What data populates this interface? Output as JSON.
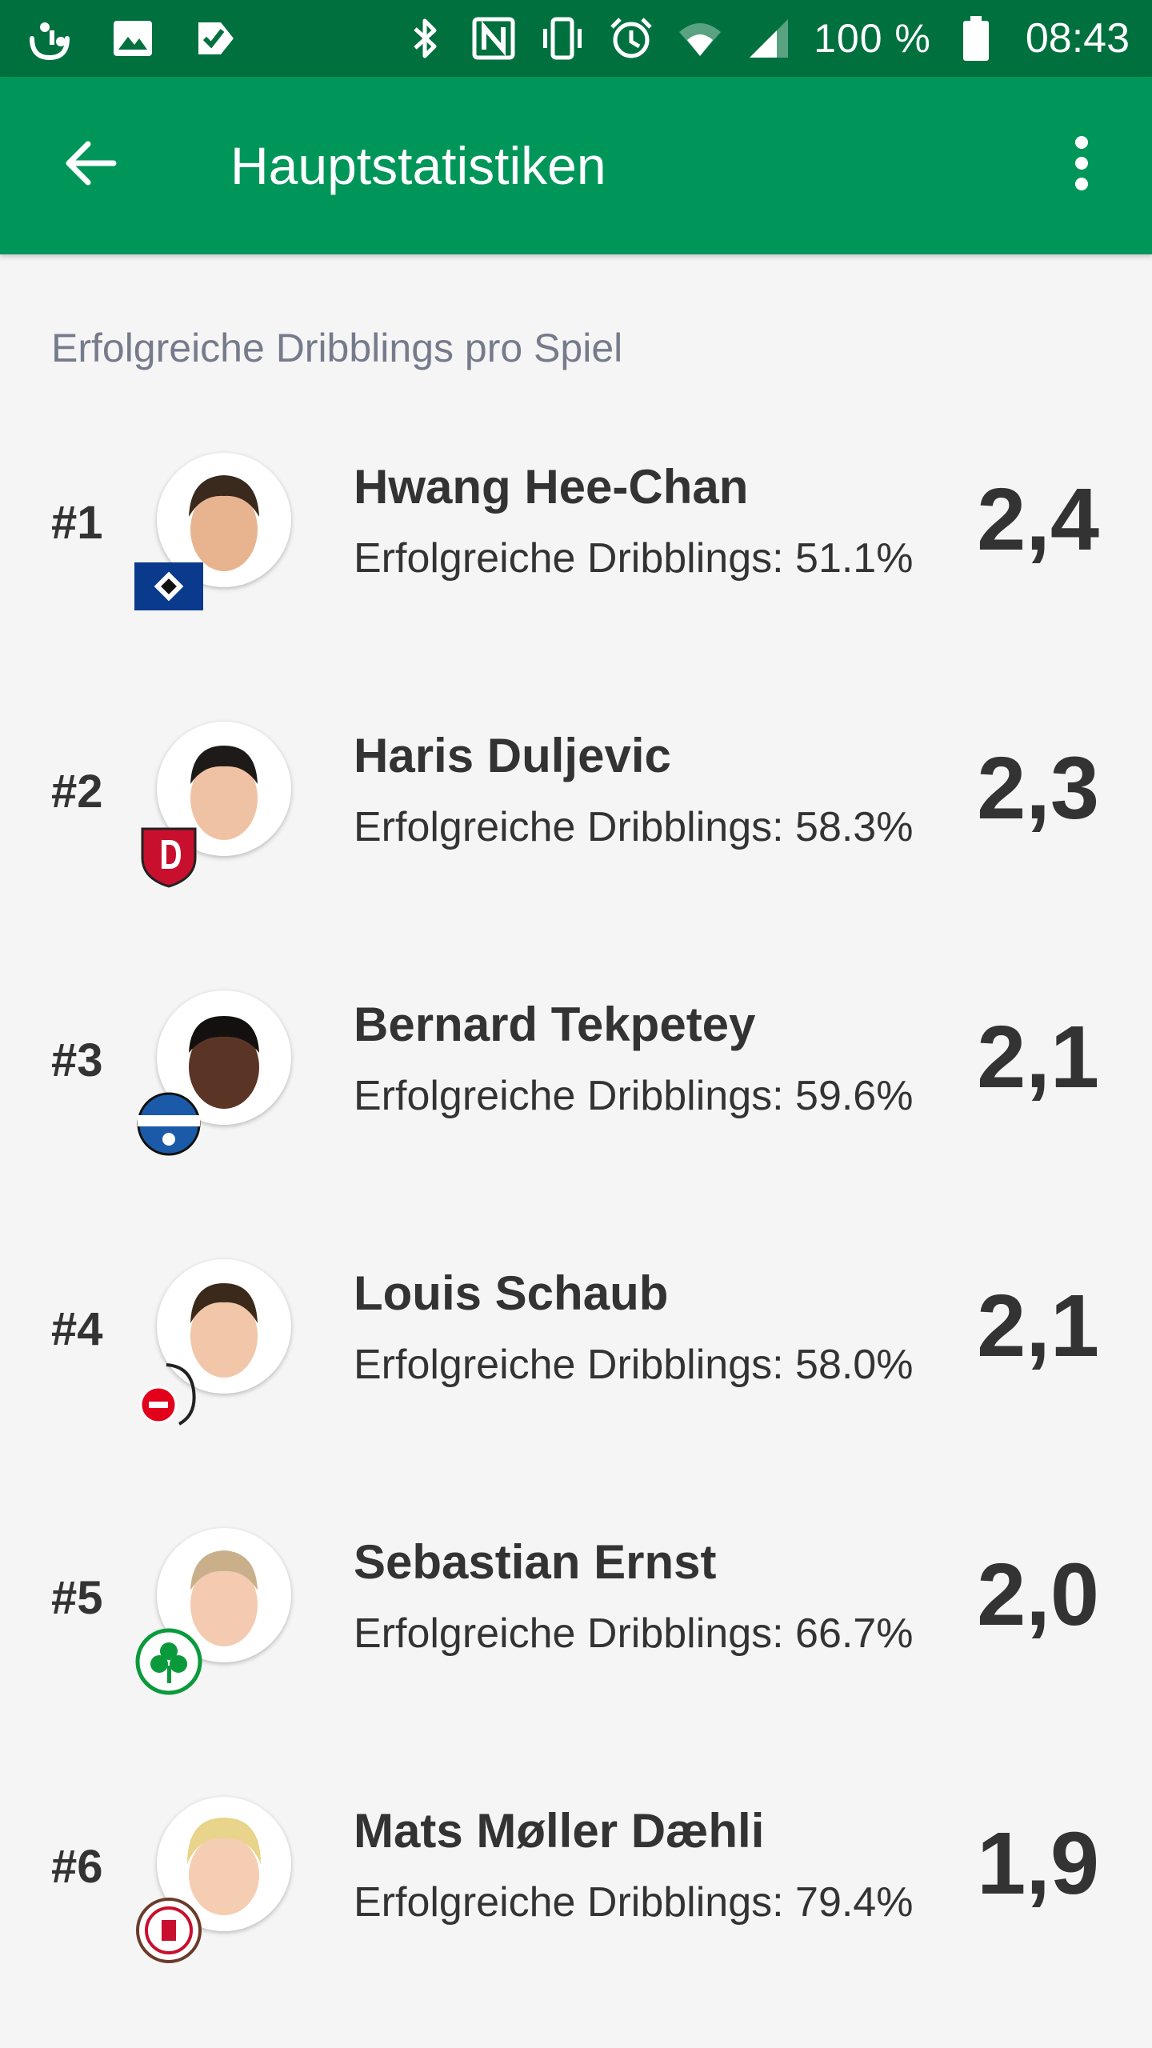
{
  "status_bar": {
    "battery_text": "100 %",
    "time": "08:43",
    "left_icons": [
      "touch-icon",
      "gallery-icon",
      "tasks-icon"
    ],
    "right_icons": [
      "bluetooth-icon",
      "nfc-icon",
      "vibrate-icon",
      "alarm-icon",
      "wifi-icon",
      "signal-icon",
      "battery-icon"
    ]
  },
  "app_bar": {
    "title": "Hauptstatistiken",
    "color": "#00965a",
    "status_color": "#00703f"
  },
  "section": {
    "title": "Erfolgreiche Dribblings pro Spiel"
  },
  "players": [
    {
      "rank": "#1",
      "name": "Hwang Hee-Chan",
      "stat": "Erfolgreiche Dribblings: 51.1%",
      "value": "2,4",
      "club": "hsv-crest-icon",
      "skin": "#e8b48f",
      "hair": "#3a2a1e"
    },
    {
      "rank": "#2",
      "name": "Haris Duljevic",
      "stat": "Erfolgreiche Dribblings: 58.3%",
      "value": "2,3",
      "club": "dresden-crest-icon",
      "skin": "#f0c2a4",
      "hair": "#1e1a18"
    },
    {
      "rank": "#3",
      "name": "Bernard Tekpetey",
      "stat": "Erfolgreiche Dribblings: 59.6%",
      "value": "2,1",
      "club": "paderborn-crest-icon",
      "skin": "#5a3526",
      "hair": "#141010"
    },
    {
      "rank": "#4",
      "name": "Louis Schaub",
      "stat": "Erfolgreiche Dribblings: 58.0%",
      "value": "2,1",
      "club": "koeln-crest-icon",
      "skin": "#f2c6a8",
      "hair": "#3b2a1c"
    },
    {
      "rank": "#5",
      "name": "Sebastian Ernst",
      "stat": "Erfolgreiche Dribblings: 66.7%",
      "value": "2,0",
      "club": "fuerth-crest-icon",
      "skin": "#f4cbb0",
      "hair": "#c9b08a"
    },
    {
      "rank": "#6",
      "name": "Mats Møller Dæhli",
      "stat": "Erfolgreiche Dribblings: 79.4%",
      "value": "1,9",
      "club": "stpauli-crest-icon",
      "skin": "#f5cdb2",
      "hair": "#e8d48a"
    }
  ]
}
